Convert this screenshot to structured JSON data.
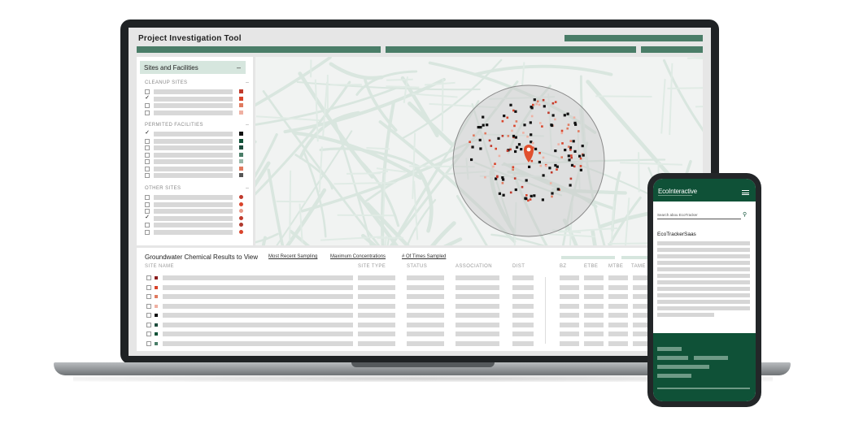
{
  "app": {
    "title": "Project Investigation Tool"
  },
  "sidebar": {
    "heading": "Sites and Facilities",
    "collapse_symbol": "–",
    "sections": [
      {
        "title": "CLEANUP SITES",
        "marker": "square",
        "rows": [
          {
            "checked": false,
            "color": "#c0392b"
          },
          {
            "checked": true,
            "color": "#d9442b"
          },
          {
            "checked": false,
            "color": "#e07a5f"
          },
          {
            "checked": false,
            "color": "#efb0a2"
          }
        ]
      },
      {
        "title": "PERMITED FACILITIES",
        "marker": "square",
        "rows": [
          {
            "checked": true,
            "color": "#111111"
          },
          {
            "checked": false,
            "color": "#0f5137"
          },
          {
            "checked": false,
            "color": "#1f4d3d"
          },
          {
            "checked": false,
            "color": "#4a7d68"
          },
          {
            "checked": false,
            "color": "#9ab8aa"
          },
          {
            "checked": false,
            "color": "#e07a5f"
          },
          {
            "checked": false,
            "color": "#555555"
          }
        ]
      },
      {
        "title": "OTHER SITES",
        "marker": "dot",
        "rows": [
          {
            "checked": false,
            "color": "#c0392b"
          },
          {
            "checked": false,
            "color": "#d9442b"
          },
          {
            "checked": false,
            "color": "#e89a8a"
          },
          {
            "checked": true,
            "color": "#c0392b"
          },
          {
            "checked": false,
            "color": "#b03a2e"
          },
          {
            "checked": false,
            "color": "#d9442b"
          }
        ]
      }
    ]
  },
  "table": {
    "title": "Groundwater Chemical Results to View",
    "links": [
      "Most Recent Sampling",
      "Maximum Concentrations",
      "# Of Times Sampled"
    ],
    "columns": [
      "SITE NAME",
      "SITE TYPE",
      "STATUS",
      "ASSOCIATION",
      "DIST",
      "BZ",
      "ETBE",
      "MTBE",
      "TAME"
    ],
    "row_colors": [
      "#8b1e1e",
      "#d9442b",
      "#e07a5f",
      "#efb0a2",
      "#111111",
      "#1f4d3d",
      "#0f5137",
      "#4a7d68"
    ]
  },
  "phone": {
    "logo": "EcoInteractive",
    "search_placeholder": "Search abou EcoTracker",
    "search_icon": "search-icon",
    "product_name": "EcoTrackerSaas"
  },
  "colors": {
    "brand_dark": "#0f5137",
    "brand_bar": "#4a7d68",
    "accent_red": "#d9442b"
  }
}
